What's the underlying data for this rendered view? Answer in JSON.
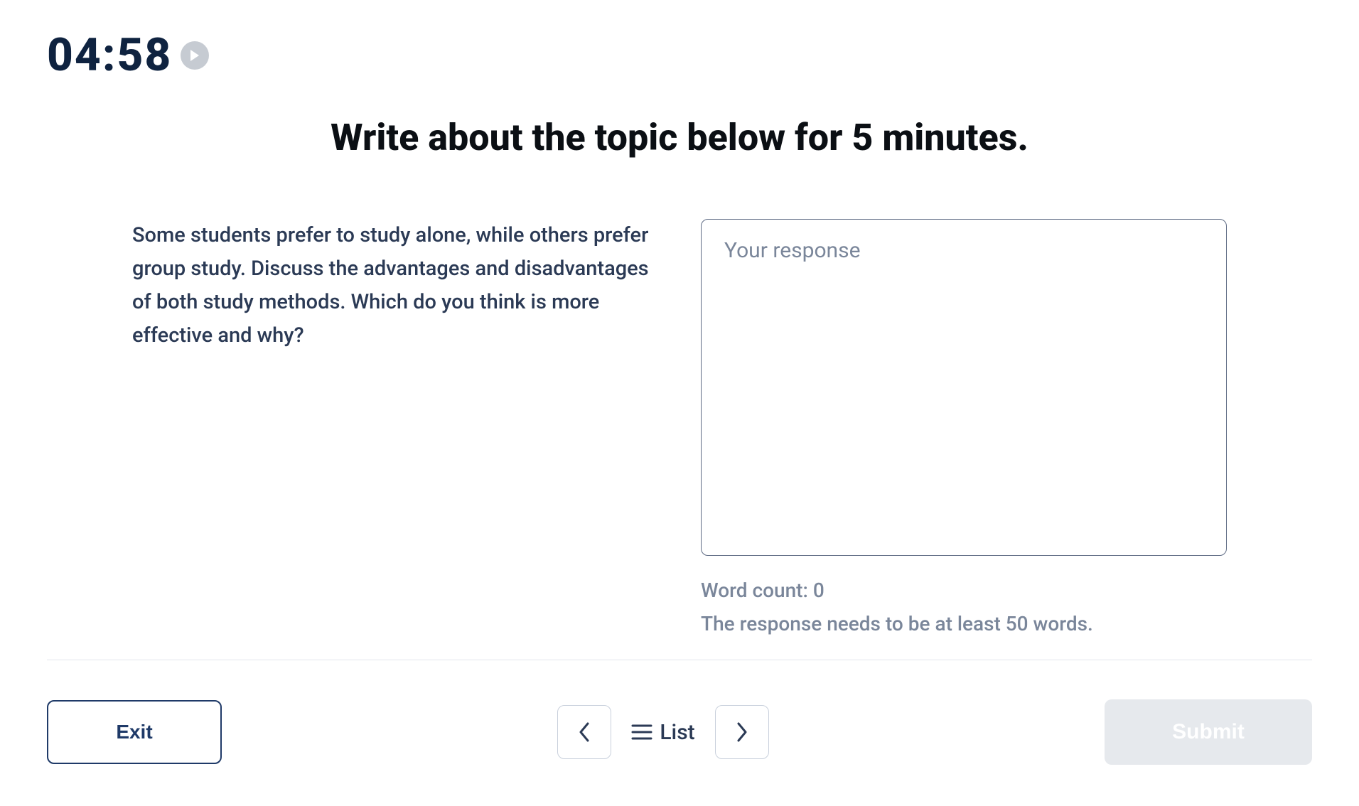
{
  "timer": {
    "value": "04:58"
  },
  "headline": "Write about the topic below for 5 minutes.",
  "prompt": "Some students prefer to study alone, while others prefer group study. Discuss the advantages and disadvantages of both study methods. Which do you think is more effective and why?",
  "response": {
    "placeholder": "Your response",
    "word_count_label": "Word count: 0",
    "min_words_label": "The response needs to be at least 50 words."
  },
  "footer": {
    "exit_label": "Exit",
    "list_label": "List",
    "submit_label": "Submit"
  }
}
